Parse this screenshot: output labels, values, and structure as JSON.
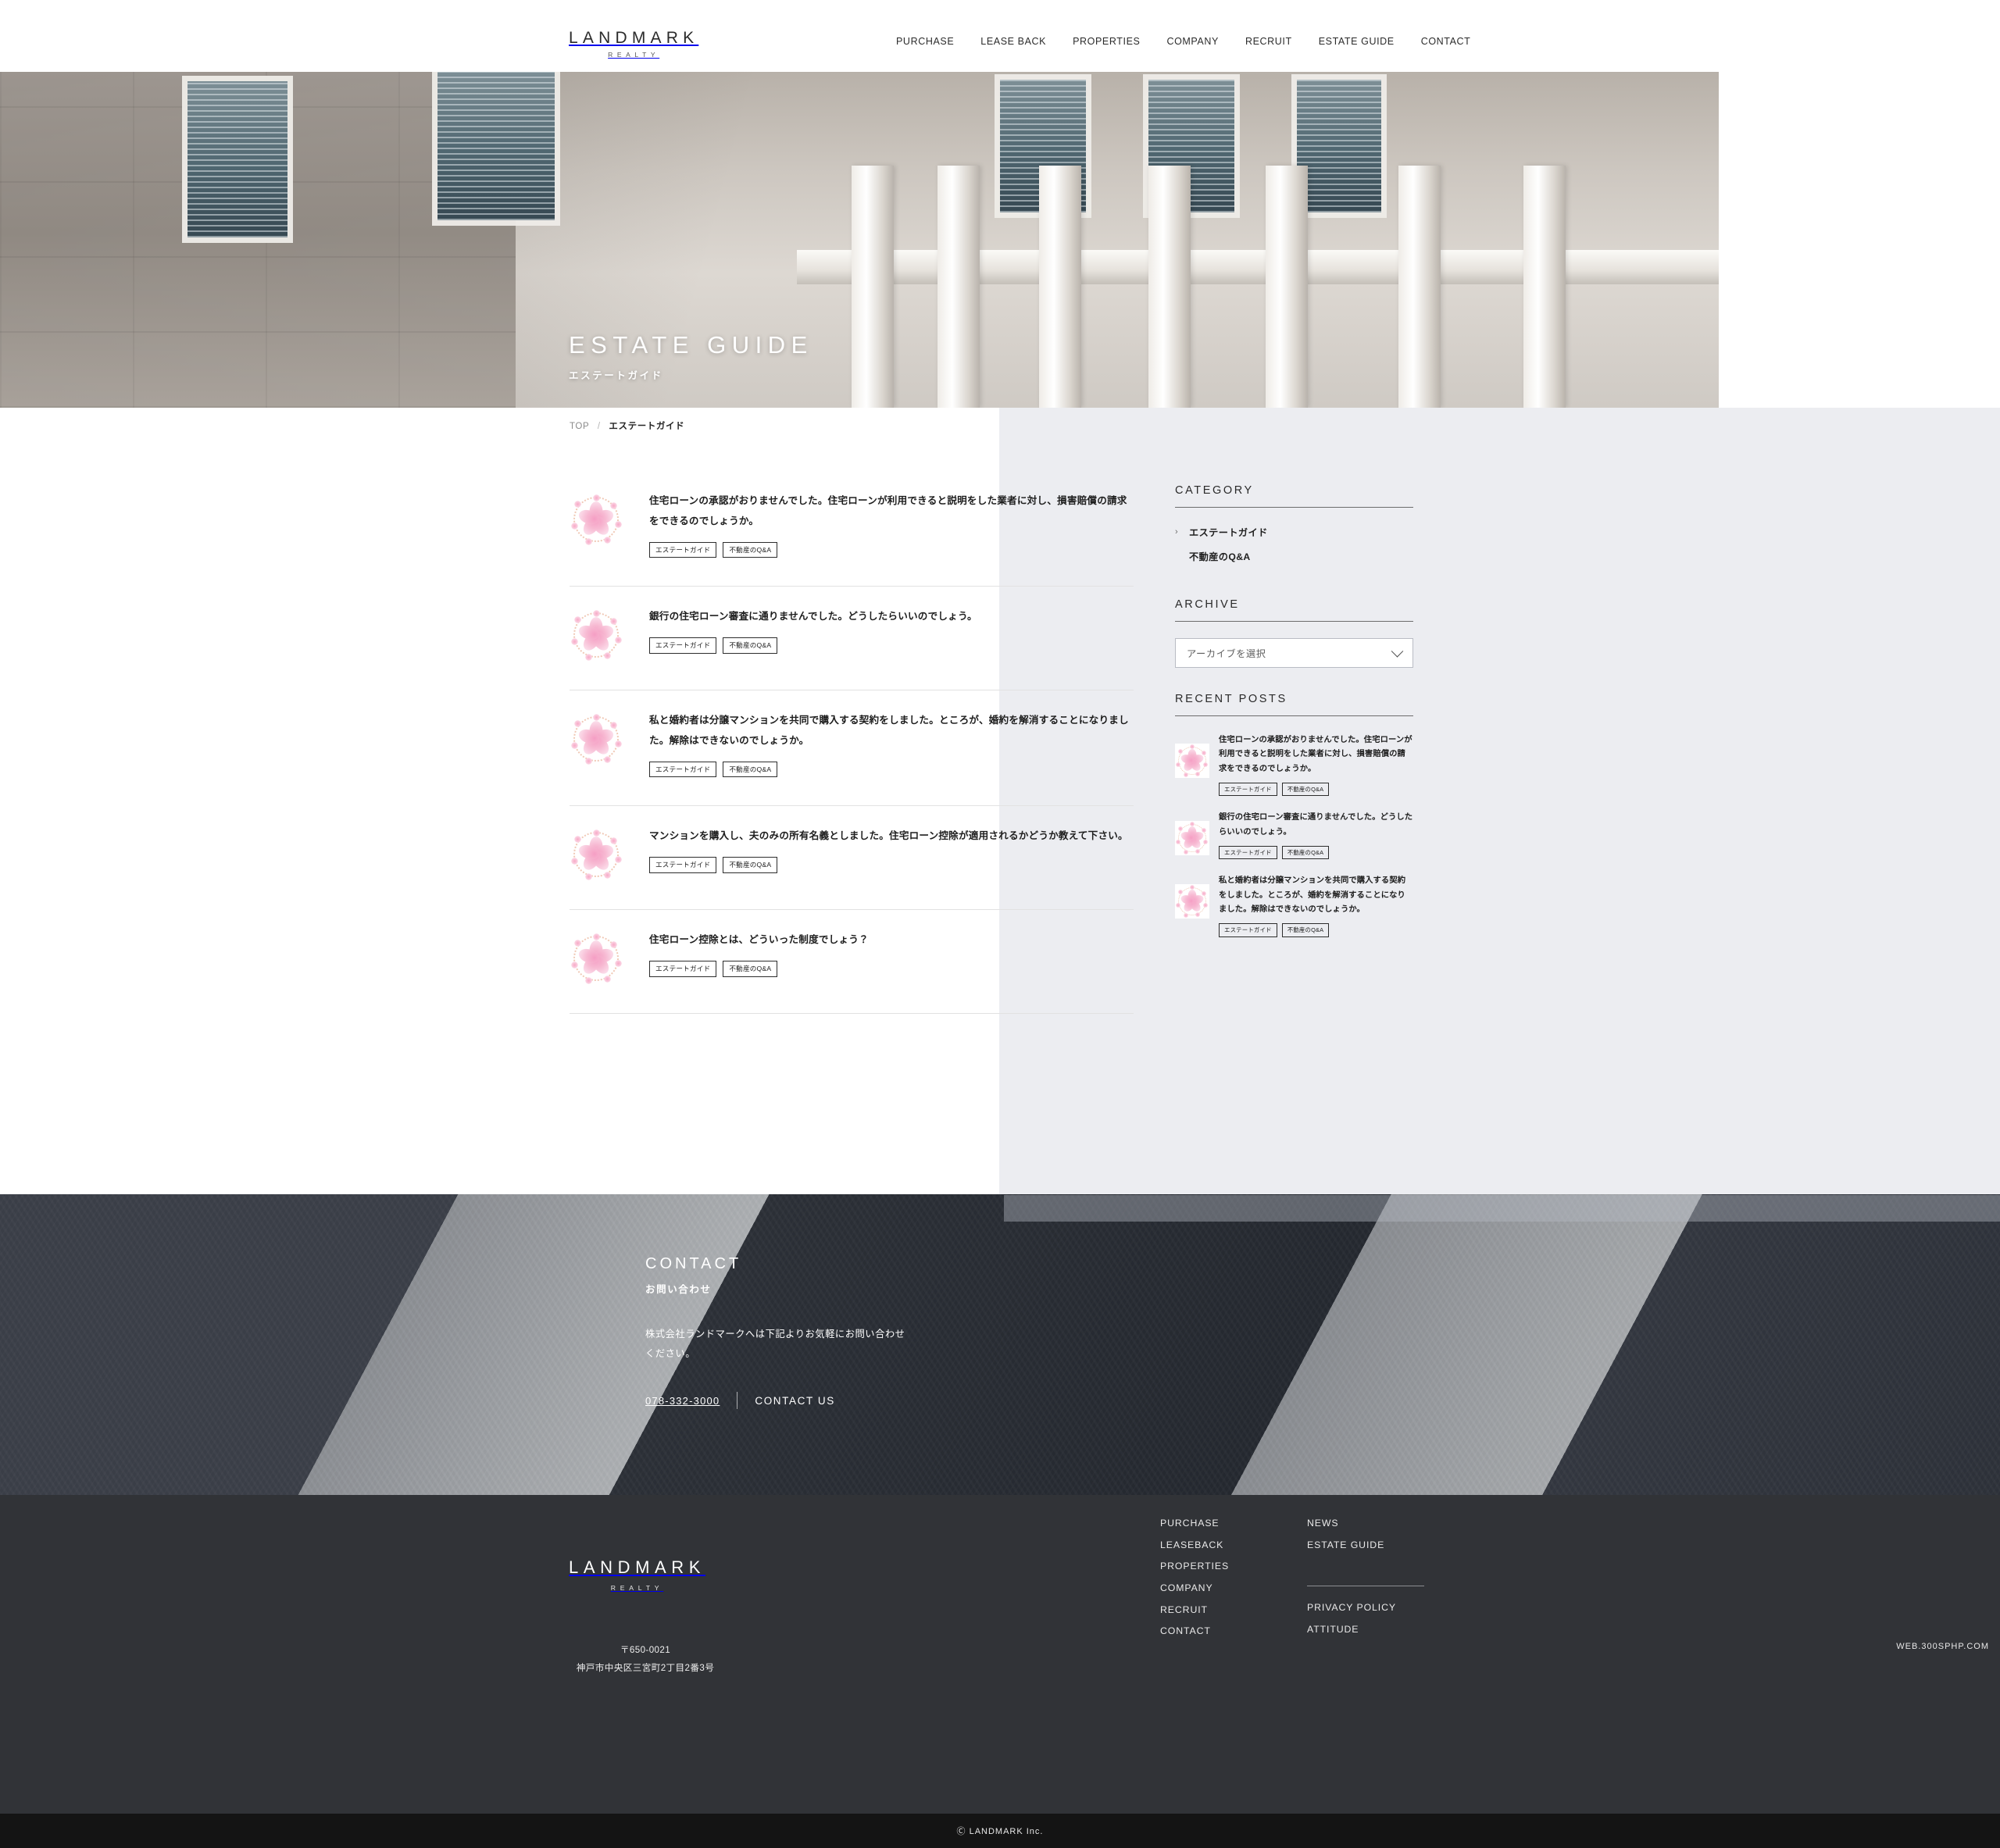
{
  "header": {
    "brand_main": "LANDMARK",
    "brand_sub": "REALTY",
    "nav": [
      {
        "label": "PURCHASE"
      },
      {
        "label": "LEASE BACK"
      },
      {
        "label": "PROPERTIES"
      },
      {
        "label": "COMPANY"
      },
      {
        "label": "RECRUIT"
      },
      {
        "label": "ESTATE GUIDE"
      },
      {
        "label": "CONTACT"
      }
    ]
  },
  "hero": {
    "title": "ESTATE GUIDE",
    "subtitle": "エステートガイド"
  },
  "breadcrumb": {
    "home": "TOP",
    "separator": "/",
    "current": "エステートガイド"
  },
  "posts": [
    {
      "title": "住宅ローンの承認がおりませんでした。住宅ローンが利用できると説明をした業者に対し、損害賠償の請求をできるのでしょうか。",
      "tags": [
        "エステートガイド",
        "不動産のQ&A"
      ]
    },
    {
      "title": "銀行の住宅ローン審査に通りませんでした。どうしたらいいのでしょう。",
      "tags": [
        "エステートガイド",
        "不動産のQ&A"
      ]
    },
    {
      "title": "私と婚約者は分譲マンションを共同で購入する契約をしました。ところが、婚約を解消することになりました。解除はできないのでしょうか。",
      "tags": [
        "エステートガイド",
        "不動産のQ&A"
      ]
    },
    {
      "title": "マンションを購入し、夫のみの所有名義としました。住宅ローン控除が適用されるかどうか教えて下さい。",
      "tags": [
        "エステートガイド",
        "不動産のQ&A"
      ]
    },
    {
      "title": "住宅ローン控除とは、どういった制度でしょう？",
      "tags": [
        "エステートガイド",
        "不動産のQ&A"
      ]
    }
  ],
  "sidebar": {
    "category_heading": "CATEGORY",
    "categories": [
      {
        "label": "エステートガイド",
        "chevron": "›",
        "child": false
      },
      {
        "label": "不動産のQ&A",
        "chevron": "",
        "child": true
      }
    ],
    "archive_heading": "ARCHIVE",
    "archive_select_value": "アーカイブを選択",
    "recent_heading": "RECENT POSTS",
    "recent_posts": [
      {
        "title": "住宅ローンの承認がおりませんでした。住宅ローンが利用できると説明をした業者に対し、損害賠償の請求をできるのでしょうか。",
        "tags": [
          "エステートガイド",
          "不動産のQ&A"
        ]
      },
      {
        "title": "銀行の住宅ローン審査に通りませんでした。どうしたらいいのでしょう。",
        "tags": [
          "エステートガイド",
          "不動産のQ&A"
        ]
      },
      {
        "title": "私と婚約者は分譲マンションを共同で購入する契約をしました。ところが、婚約を解消することになりました。解除はできないのでしょうか。",
        "tags": [
          "エステートガイド",
          "不動産のQ&A"
        ]
      }
    ]
  },
  "contact": {
    "title": "CONTACT",
    "subtitle": "お問い合わせ",
    "text": "株式会社ランドマークへは下記よりお気軽にお問い合わせください。",
    "tel": "078-332-3000",
    "cta": "CONTACT US"
  },
  "footer": {
    "brand_main": "LANDMARK",
    "brand_sub": "REALTY",
    "postal": "〒650-0021",
    "address": "神戸市中央区三宮町2丁目2番3号",
    "nav_primary": [
      {
        "label": "PURCHASE"
      },
      {
        "label": "LEASEBACK"
      },
      {
        "label": "PROPERTIES"
      },
      {
        "label": "COMPANY"
      },
      {
        "label": "RECRUIT"
      },
      {
        "label": "CONTACT"
      }
    ],
    "nav_secondary": [
      {
        "label": "NEWS"
      },
      {
        "label": "ESTATE GUIDE"
      }
    ],
    "nav_tertiary": [
      {
        "label": "PRIVACY POLICY"
      },
      {
        "label": "ATTITUDE"
      }
    ],
    "copyright": "Ⓒ LANDMARK Inc.",
    "watermark": "WEB.300SPHP.COM"
  },
  "colors": {
    "panel_gray": "#ecedf1",
    "footer_dark": "#313337",
    "copyright_dark": "#141414",
    "text_dark": "#1d1d1d"
  }
}
